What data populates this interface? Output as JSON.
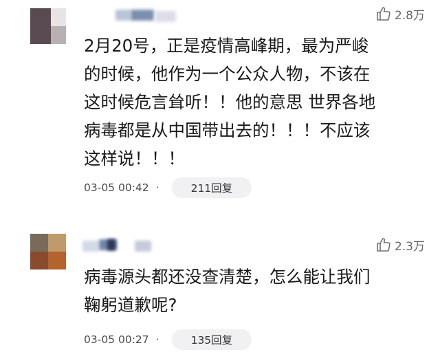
{
  "comments": [
    {
      "likes": "2.8万",
      "lines": [
        "2月20号，正是疫情高峰期，最为严峻",
        "的时候，他作为一个公众人物，不该在",
        "这时候危言耸听！！他的意思 世界各地",
        "病毒都是从中国带出去的！！！不应该",
        "这样说！！！"
      ],
      "timestamp": "03-05 00:42",
      "separator": "·",
      "reply_label": "211回复"
    },
    {
      "likes": "2.3万",
      "lines": [
        "病毒源头都还没查清楚，怎么能让我们",
        "鞠躬道歉呢?"
      ],
      "timestamp": "03-05 00:27",
      "separator": "·",
      "reply_label": "135回复"
    }
  ],
  "icons": {
    "like": "thumbs-up-outline-icon"
  },
  "colors": {
    "text": "#1a1a1a",
    "meta": "#4a4a4a",
    "likes": "#666666",
    "pill_bg": "#f1f1f3"
  }
}
